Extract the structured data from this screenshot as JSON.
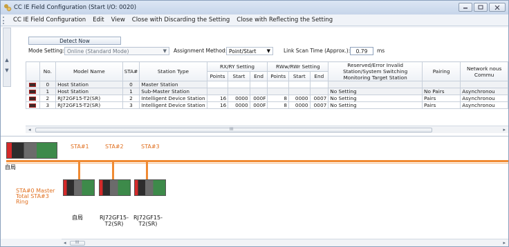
{
  "window": {
    "title": "CC IE Field Configuration (Start I/O: 0020)"
  },
  "menu": [
    "CC IE Field Configuration",
    "Edit",
    "View",
    "Close with Discarding the Setting",
    "Close with Reflecting the Setting"
  ],
  "toolbar": {
    "detect_now": "Detect Now",
    "mode_setting_label": "Mode Setting:",
    "mode_setting_value": "Online (Standard Mode)",
    "assignment_label": "Assignment Method:",
    "assignment_value": "Point/Start",
    "scan_label": "Link Scan Time (Approx.):",
    "scan_value": "0.79",
    "scan_unit": "ms"
  },
  "table": {
    "headers": {
      "no": "No.",
      "model": "Model Name",
      "sta": "STA#",
      "type": "Station Type",
      "rxry": "RX/RY Setting",
      "rwwrwr": "RWw/RWr Setting",
      "reserved": "Reserved/Error Invalid Station/System Switching Monitoring Target Station",
      "pairing": "Pairing",
      "network": "Network nous Commu",
      "points": "Points",
      "start": "Start",
      "end": "End"
    },
    "rows": [
      {
        "no": "0",
        "model": "Host Station",
        "sta": "0",
        "type": "Master Station",
        "rx_points": "",
        "rx_start": "",
        "rx_end": "",
        "rw_points": "",
        "rw_start": "",
        "rw_end": "",
        "reserved": "",
        "pairing": "",
        "network": ""
      },
      {
        "no": "1",
        "model": "Host Station",
        "sta": "1",
        "type": "Sub-Master Station",
        "rx_points": "",
        "rx_start": "",
        "rx_end": "",
        "rw_points": "",
        "rw_start": "",
        "rw_end": "",
        "reserved": "No Setting",
        "pairing": "No Pairs",
        "network": "Asynchronou"
      },
      {
        "no": "2",
        "model": "RJ72GF15-T2(SR)",
        "sta": "2",
        "type": "Intelligent Device Station",
        "rx_points": "16",
        "rx_start": "0000",
        "rx_end": "000F",
        "rw_points": "8",
        "rw_start": "0000",
        "rw_end": "0007",
        "reserved": "No Setting",
        "pairing": "Pairs",
        "network": "Asynchronou"
      },
      {
        "no": "3",
        "model": "RJ72GF15-T2(SR)",
        "sta": "3",
        "type": "Intelligent Device Station",
        "rx_points": "16",
        "rx_start": "0000",
        "rx_end": "000F",
        "rw_points": "8",
        "rw_start": "0000",
        "rw_end": "0007",
        "reserved": "No Setting",
        "pairing": "Pairs",
        "network": "Asynchronou"
      }
    ],
    "hscroll_text": "III"
  },
  "diagram": {
    "sta_labels": [
      "STA#1",
      "STA#2",
      "STA#3"
    ],
    "host_label": "自局",
    "master_info": [
      "STA#0  Master",
      "Total STA#3",
      "Ring"
    ],
    "bottom_labels": [
      "自局",
      "RJ72GF15-\nT2(SR)",
      "RJ72GF15-\nT2(SR)"
    ],
    "hscroll_text": "III"
  },
  "colors": {
    "accent": "#f08a32",
    "plc_red": "#d42a2a",
    "plc_green": "#3d8a4a"
  }
}
